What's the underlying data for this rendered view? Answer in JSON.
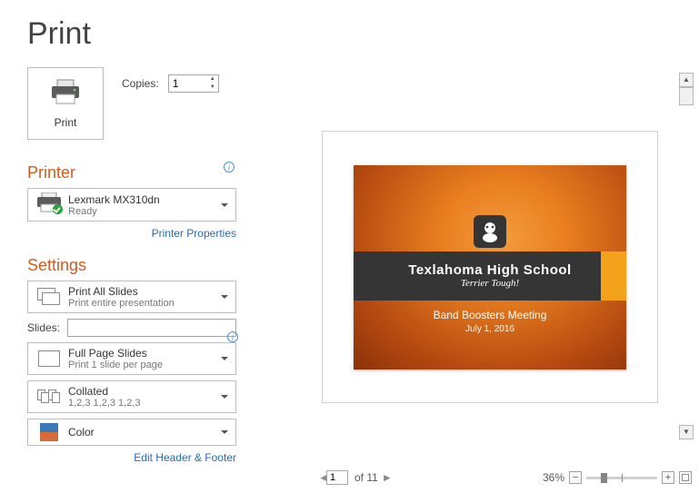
{
  "page_title": "Print",
  "print_button_label": "Print",
  "copies": {
    "label": "Copies:",
    "value": "1"
  },
  "printer_section": {
    "title": "Printer",
    "selected": {
      "name": "Lexmark MX310dn",
      "status": "Ready"
    },
    "properties_link": "Printer Properties"
  },
  "settings_section": {
    "title": "Settings",
    "print_what": {
      "line1": "Print All Slides",
      "line2": "Print entire presentation"
    },
    "slides_label": "Slides:",
    "slides_value": "",
    "layout": {
      "line1": "Full Page Slides",
      "line2": "Print 1 slide per page"
    },
    "collate": {
      "line1": "Collated",
      "line2": "1,2,3    1,2,3    1,2,3"
    },
    "color": {
      "line1": "Color"
    },
    "header_footer_link": "Edit Header & Footer"
  },
  "preview": {
    "slide_title": "Texlahoma High School",
    "slide_tagline": "Terrier Tough!",
    "slide_subtitle": "Band Boosters Meeting",
    "slide_date": "July 1, 2016"
  },
  "nav": {
    "current_page": "1",
    "total_pages_label": "of 11",
    "zoom_label": "36%"
  },
  "colors": {
    "accent": "#d45b1f"
  }
}
